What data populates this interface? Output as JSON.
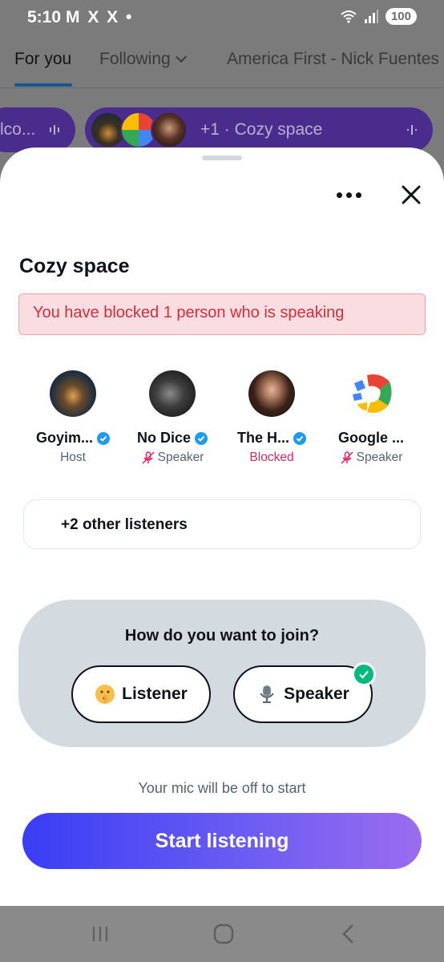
{
  "status_bar": {
    "time": "5:10",
    "notification_icons": "M X X •",
    "battery": "100"
  },
  "tabs": [
    {
      "label": "For you",
      "active": true
    },
    {
      "label": "Following",
      "active": false
    },
    {
      "label": "America First - Nick Fuentes",
      "active": false
    }
  ],
  "space_pills": [
    {
      "label": "lco..."
    },
    {
      "label": "+1 · Cozy space"
    }
  ],
  "sheet": {
    "title": "Cozy space",
    "blocked_banner": "You have blocked 1 person who is speaking",
    "participants": [
      {
        "name": "Goyim...",
        "verified": true,
        "role": "Host",
        "muted": false,
        "blocked": false
      },
      {
        "name": "No Dice",
        "verified": true,
        "role": "Speaker",
        "muted": true,
        "blocked": false
      },
      {
        "name": "The H...",
        "verified": true,
        "role": "Blocked",
        "muted": false,
        "blocked": true
      },
      {
        "name": "Google ...",
        "verified": false,
        "role": "Speaker",
        "muted": true,
        "blocked": false
      }
    ],
    "listeners_label": "+2 other listeners",
    "join": {
      "question": "How do you want to join?",
      "listener_label": "Listener",
      "speaker_label": "Speaker",
      "selected": "Speaker"
    },
    "mic_note": "Your mic will be off to start",
    "start_button": "Start listening"
  },
  "colors": {
    "accent_purple": "#4a2c8c",
    "verified_blue": "#1d9bf0",
    "blocked_red": "#e0245e",
    "check_green": "#00ba7c"
  },
  "icons": [
    "wifi-icon",
    "signal-icon",
    "more-icon",
    "close-icon",
    "verified-icon",
    "mic-off-icon",
    "shush-emoji-icon",
    "microphone-icon",
    "check-icon",
    "recents-icon",
    "home-icon",
    "back-icon"
  ]
}
